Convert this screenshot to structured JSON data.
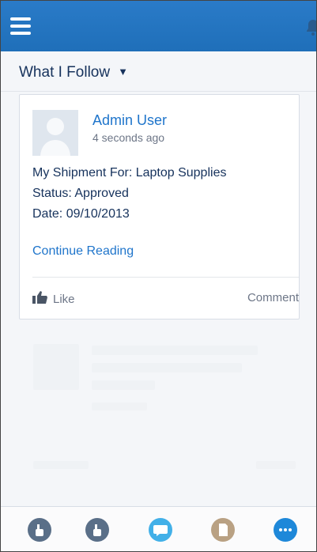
{
  "header": {
    "menu_icon": "hamburger-icon",
    "notification_icon": "bell-icon",
    "accent": "#1f72c2"
  },
  "feed": {
    "title": "What I Follow",
    "caret": "▼"
  },
  "post": {
    "author": "Admin User",
    "timestamp": "4 seconds ago",
    "lines": [
      "My Shipment For: Laptop Supplies",
      "Status: Approved",
      "Date: 09/10/2013"
    ],
    "continue_label": "Continue Reading",
    "like_label": "Like",
    "comment_label": "Comment"
  },
  "bottom_nav": [
    {
      "icon": "app-icon",
      "color": "#5a6f88"
    },
    {
      "icon": "app-icon",
      "color": "#5a6f88"
    },
    {
      "icon": "chat-icon",
      "color": "#42b0e8"
    },
    {
      "icon": "document-icon",
      "color": "#b9a183"
    },
    {
      "icon": "more-icon",
      "color": "#1e88d9"
    }
  ]
}
